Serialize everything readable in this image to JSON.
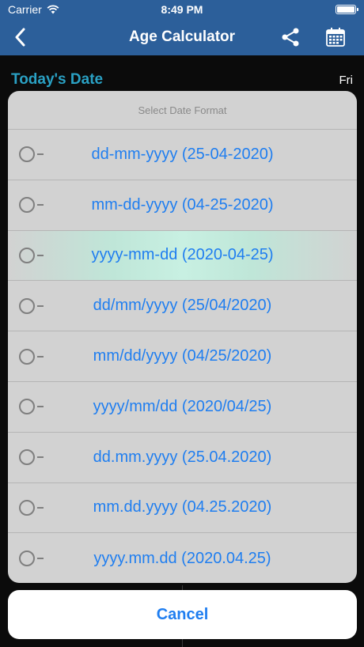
{
  "status_bar": {
    "carrier": "Carrier",
    "time": "8:49 PM"
  },
  "nav": {
    "title": "Age Calculator",
    "icons": [
      "chevron-left-icon",
      "share-icon",
      "calendar-icon"
    ]
  },
  "background": {
    "section_title": "Today's Date",
    "day": "Fri"
  },
  "sheet": {
    "header": "Select Date Format",
    "selected_index": 2,
    "options": [
      "dd-mm-yyyy (25-04-2020)",
      "mm-dd-yyyy (04-25-2020)",
      "yyyy-mm-dd (2020-04-25)",
      "dd/mm/yyyy (25/04/2020)",
      "mm/dd/yyyy (04/25/2020)",
      "yyyy/mm/dd (2020/04/25)",
      "dd.mm.yyyy (25.04.2020)",
      "mm.dd.yyyy (04.25.2020)",
      "yyyy.mm.dd (2020.04.25)"
    ]
  },
  "cancel_label": "Cancel",
  "colors": {
    "nav": "#2c5f9a",
    "accent": "#1f7ef0",
    "section": "#2aa1c4",
    "selected": "#c8f0e2"
  }
}
